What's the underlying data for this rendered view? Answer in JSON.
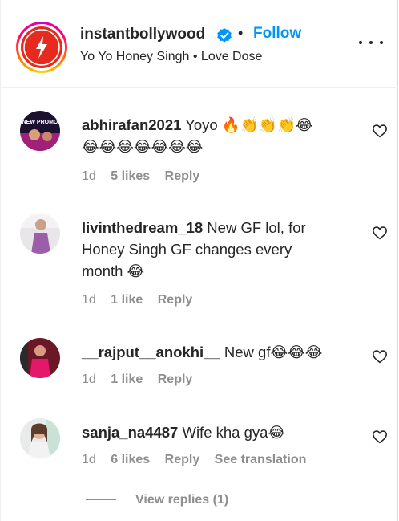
{
  "header": {
    "username": "instantbollywood",
    "separator": "•",
    "follow_label": "Follow",
    "subtitle": "Yo Yo Honey Singh • Love Dose"
  },
  "comments": [
    {
      "user": "abhirafan2021",
      "text": "Yoyo 🔥👏👏👏😂",
      "text2": "😂😂😂😂😂😂😂",
      "time": "1d",
      "likes": "5 likes",
      "reply": "Reply",
      "avatar_label": "NEW PROMO"
    },
    {
      "user": "livinthedream_18",
      "text": "New GF lol, for",
      "text2": "Honey Singh GF changes every",
      "text3": "month 😂",
      "time": "1d",
      "likes": "1 like",
      "reply": "Reply"
    },
    {
      "user": "__rajput__anokhi__",
      "text": "New gf😂😂😂",
      "time": "1d",
      "likes": "1 like",
      "reply": "Reply"
    },
    {
      "user": "sanja_na4487",
      "text": "Wife kha gya😂",
      "time": "1d",
      "likes": "6 likes",
      "reply": "Reply",
      "translation": "See translation"
    }
  ],
  "view_replies": "View replies (1)",
  "colors": {
    "accent": "#0095f6",
    "muted": "#8e8e8e",
    "text": "#262626"
  }
}
